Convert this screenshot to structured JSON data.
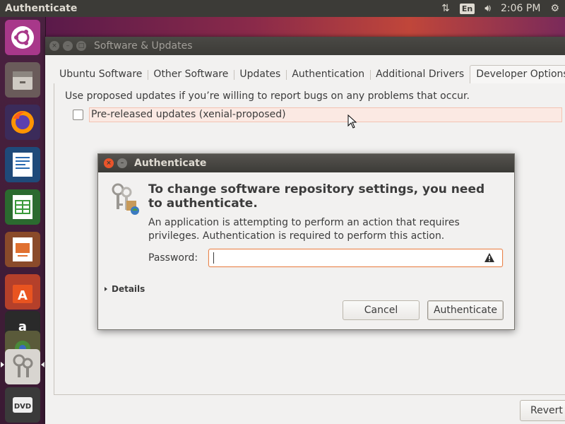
{
  "top_panel": {
    "title": "Authenticate",
    "keyboard_layout": "En",
    "time": "2:06 PM"
  },
  "launcher": {
    "items": [
      "ubuntu-dash",
      "files",
      "firefox",
      "libreoffice-writer",
      "libreoffice-calc",
      "libreoffice-impress",
      "ubuntu-software",
      "amazon",
      "system-settings",
      "passwords-and-keys",
      "dvd"
    ]
  },
  "main_window": {
    "title": "Software & Updates",
    "tabs": [
      "Ubuntu Software",
      "Other Software",
      "Updates",
      "Authentication",
      "Additional Drivers",
      "Developer Options"
    ],
    "active_tab": "Developer Options",
    "hint": "Use proposed updates if you’re willing to report bugs on any problems that occur.",
    "checkbox_label": "Pre-released updates (xenial-proposed)",
    "checkbox_checked": false,
    "revert_label": "Revert"
  },
  "dialog": {
    "title": "Authenticate",
    "heading": "To change software repository settings, you need to authenticate.",
    "body": "An application is attempting to perform an action that requires privileges. Authentication is required to perform this action.",
    "password_label": "Password:",
    "password_value": "",
    "details_label": "Details",
    "cancel_label": "Cancel",
    "authenticate_label": "Authenticate"
  },
  "colors": {
    "accent_orange": "#e9844c",
    "panel": "#3c3b37",
    "launcher": "#4a2140"
  }
}
